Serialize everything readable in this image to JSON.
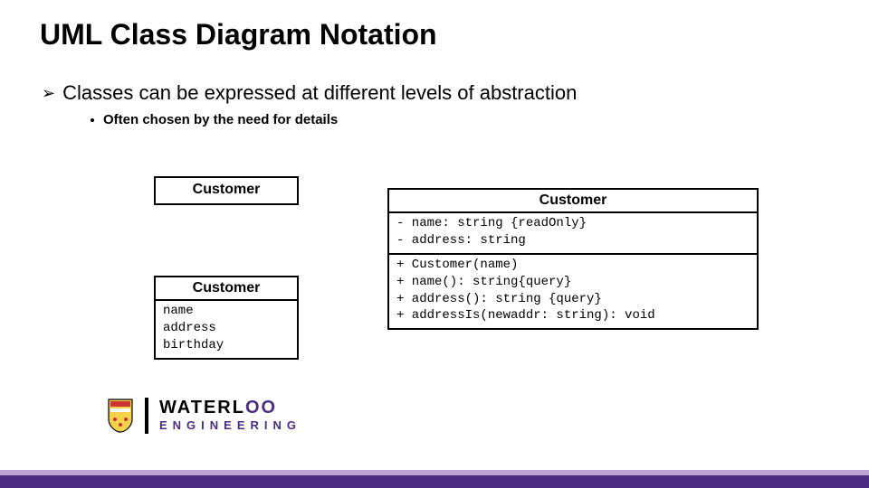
{
  "title": "UML Class Diagram Notation",
  "bullets": {
    "main": "Classes can be expressed at different levels of abstraction",
    "sub": "Often chosen by the need for details"
  },
  "uml": {
    "simple": {
      "name": "Customer"
    },
    "mid": {
      "name": "Customer",
      "attrs": [
        "name",
        "address",
        "birthday"
      ]
    },
    "detail": {
      "name": "Customer",
      "attrs": [
        "- name: string {readOnly}",
        "- address: string"
      ],
      "ops": [
        "+ Customer(name)",
        "+ name(): string{query}",
        "+ address(): string {query}",
        "+ addressIs(newaddr: string): void"
      ]
    }
  },
  "brand": {
    "line1_pre": "WATERL",
    "line1_oo": "OO",
    "line2": "ENGINEERING"
  }
}
